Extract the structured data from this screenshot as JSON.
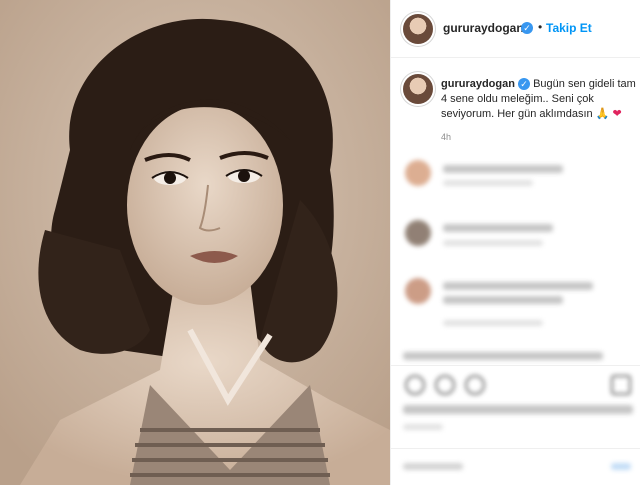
{
  "post": {
    "username": "gururaydogan",
    "follow_label": "Takip Et",
    "separator": "•",
    "caption_user": "gururaydogan",
    "caption_text": "Bugün sen gideli tam 4 sene oldu meleğim.. Seni çok seviyorum. Her gün aklımdasın",
    "caption_emoji": "🙏",
    "caption_heart": "❤",
    "verified_mark": "✓",
    "time_short": "4h"
  },
  "colors": {
    "accent": "#0095f6",
    "verified": "#3897f0",
    "text": "#262626",
    "muted": "#8e8e8e"
  },
  "icons": [
    "verified-badge-icon",
    "heart-icon",
    "comment-icon",
    "share-icon",
    "bookmark-icon"
  ]
}
